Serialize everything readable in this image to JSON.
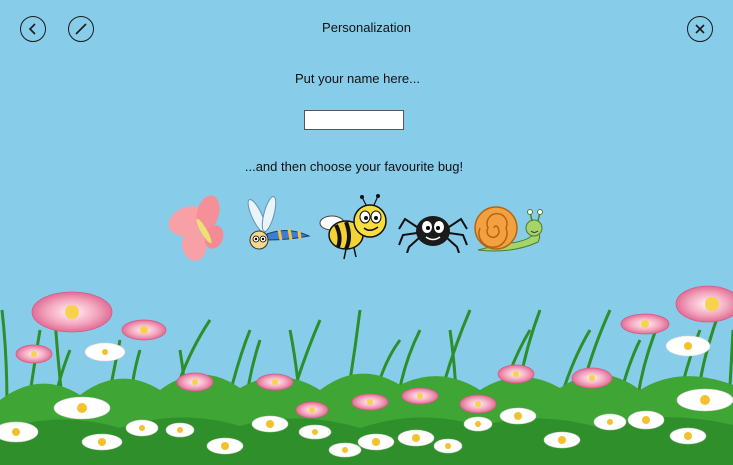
{
  "window": {
    "title": "Personalization"
  },
  "toolbar": {
    "back_icon": "back-arrow-icon",
    "edit_icon": "edit-slash-icon",
    "close_icon": "close-x-icon"
  },
  "form": {
    "name_prompt": "Put your name here...",
    "name_value": "",
    "bug_prompt": "...and then choose your favourite bug!"
  },
  "bugs": [
    "butterfly",
    "dragonfly",
    "bee",
    "spider",
    "snail"
  ],
  "colors": {
    "sky": "#87cdea",
    "grass": "#2f9a2a",
    "flower_pink": "#f48fb1"
  }
}
